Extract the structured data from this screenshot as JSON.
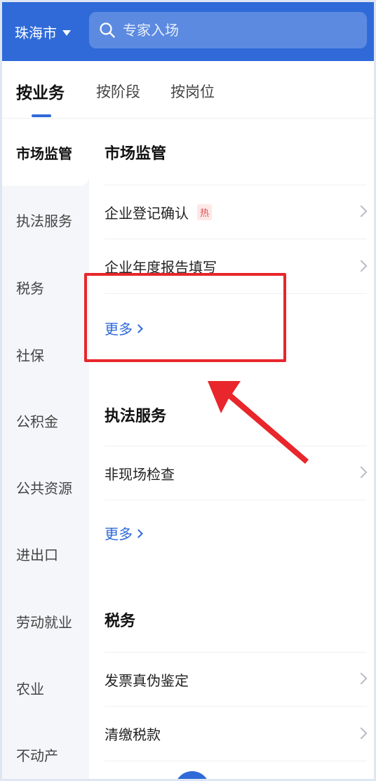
{
  "header": {
    "city": "珠海市",
    "search_placeholder": "专家入场"
  },
  "tabs": [
    {
      "label": "按业务",
      "active": true
    },
    {
      "label": "按阶段",
      "active": false
    },
    {
      "label": "按岗位",
      "active": false
    }
  ],
  "sidebar": {
    "items": [
      {
        "label": "市场监管",
        "active": true
      },
      {
        "label": "执法服务"
      },
      {
        "label": "税务"
      },
      {
        "label": "社保"
      },
      {
        "label": "公积金"
      },
      {
        "label": "公共资源"
      },
      {
        "label": "进出口"
      },
      {
        "label": "劳动就业"
      },
      {
        "label": "农业"
      },
      {
        "label": "不动产"
      }
    ]
  },
  "sections": [
    {
      "title": "市场监管",
      "items": [
        {
          "label": "企业登记确认",
          "badge": "热"
        },
        {
          "label": "企业年度报告填写"
        }
      ],
      "more": "更多"
    },
    {
      "title": "执法服务",
      "items": [
        {
          "label": "非现场检查"
        }
      ],
      "more": "更多"
    },
    {
      "title": "税务",
      "items": [
        {
          "label": "发票真伪鉴定"
        },
        {
          "label": "清缴税款"
        }
      ]
    }
  ],
  "colors": {
    "brand": "#2f6ad8",
    "annotation": "#e8262b"
  }
}
